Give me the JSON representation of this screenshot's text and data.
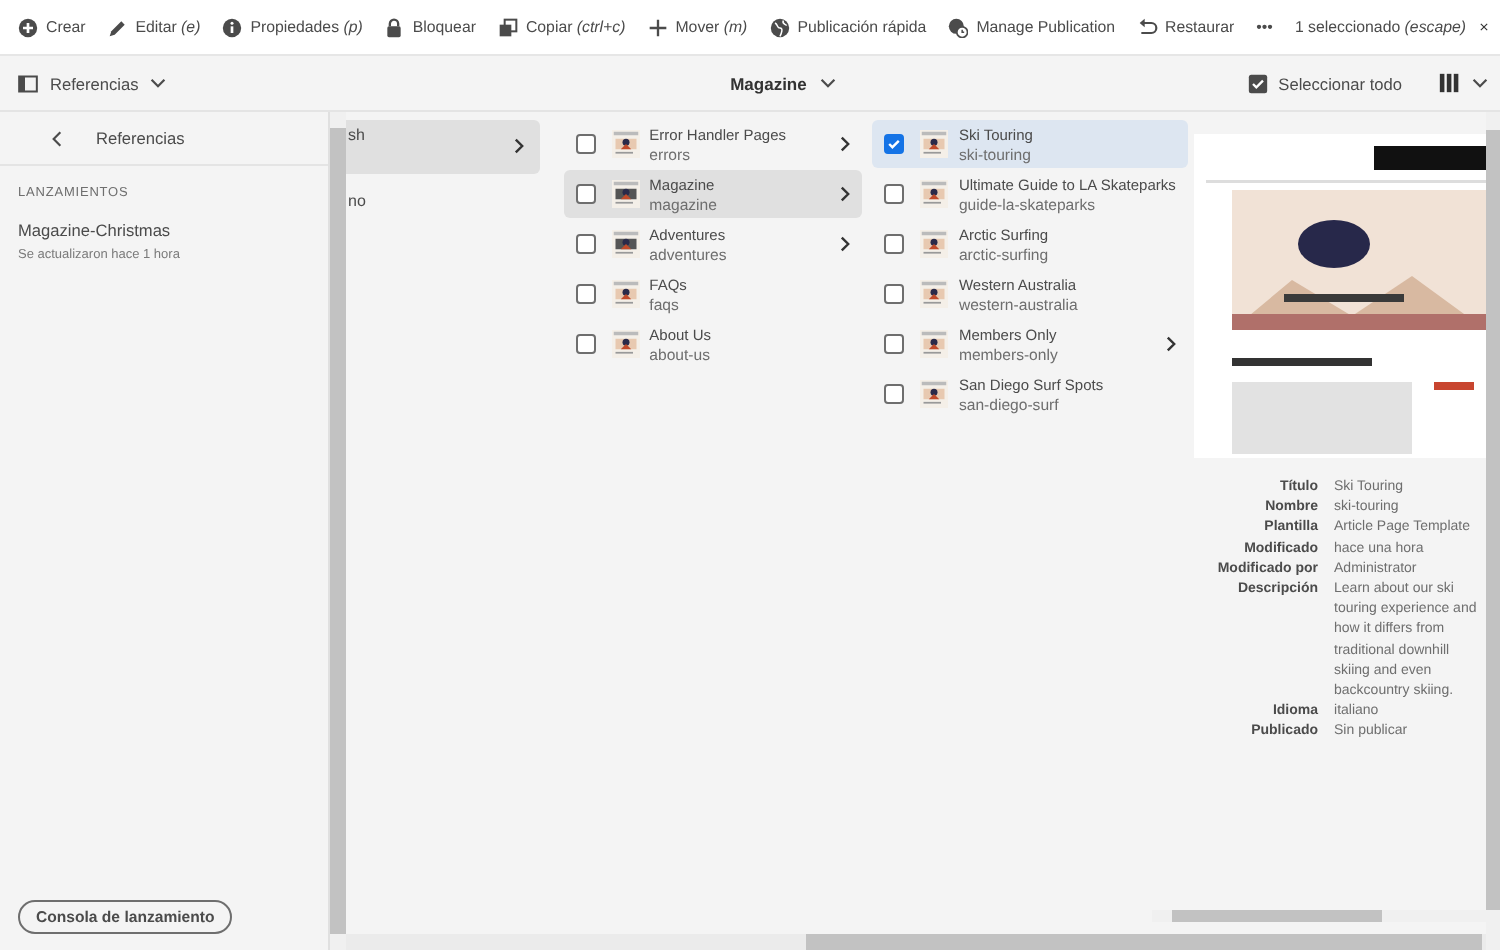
{
  "actionbar": {
    "actions": [
      {
        "kind": "create",
        "label": "Crear"
      },
      {
        "kind": "edit",
        "label": "Editar *(e)*"
      },
      {
        "kind": "info",
        "label": "Propiedades *(p)*"
      },
      {
        "kind": "lock",
        "label": "Bloquear"
      },
      {
        "kind": "copy",
        "label": "Copiar *(ctrl+c)*"
      },
      {
        "kind": "move",
        "label": "Mover *(m)*"
      },
      {
        "kind": "globe",
        "label": "Publicación rápida"
      },
      {
        "kind": "globe-clock",
        "label": "Manage Publication"
      },
      {
        "kind": "undo",
        "label": "Restaurar"
      },
      {
        "kind": "more",
        "label": "•••"
      }
    ],
    "selection": "1 seleccionado *(escape)*"
  },
  "subbar": {
    "rail_toggle": "Referencias",
    "title": "Magazine",
    "select_all": "Seleccionar todo"
  },
  "rail": {
    "title": "Referencias",
    "section": "LANZAMIENTOS",
    "launches": [
      {
        "name": "Magazine-Christmas",
        "updated": "Se actualizaron hace 1 hora"
      }
    ],
    "console_button": "Consola de lanzamiento"
  },
  "columns": [
    {
      "items": [
        {
          "title": "sh",
          "has_children": true,
          "selected": true
        },
        {
          "title": "no",
          "has_children": false,
          "selected": false
        }
      ]
    },
    {
      "items": [
        {
          "title": "Error Handler Pages",
          "name": "errors",
          "has_children": true,
          "selected": false,
          "checked": false
        },
        {
          "title": "Magazine",
          "name": "magazine",
          "has_children": true,
          "selected": true,
          "checked": false
        },
        {
          "title": "Adventures",
          "name": "adventures",
          "has_children": true,
          "selected": false,
          "checked": false
        },
        {
          "title": "FAQs",
          "name": "faqs",
          "has_children": false,
          "selected": false,
          "checked": false
        },
        {
          "title": "About Us",
          "name": "about-us",
          "has_children": false,
          "selected": false,
          "checked": false
        }
      ]
    },
    {
      "items": [
        {
          "title": "Ski Touring",
          "name": "ski-touring",
          "has_children": false,
          "selected": true,
          "checked": true
        },
        {
          "title": "Ultimate Guide to LA Skateparks",
          "name": "guide-la-skateparks",
          "has_children": false,
          "selected": false,
          "checked": false
        },
        {
          "title": "Arctic Surfing",
          "name": "arctic-surfing",
          "has_children": false,
          "selected": false,
          "checked": false
        },
        {
          "title": "Western Australia",
          "name": "western-australia",
          "has_children": false,
          "selected": false,
          "checked": false
        },
        {
          "title": "Members Only",
          "name": "members-only",
          "has_children": true,
          "selected": false,
          "checked": false
        },
        {
          "title": "San Diego Surf Spots",
          "name": "san-diego-surf",
          "has_children": false,
          "selected": false,
          "checked": false
        }
      ]
    }
  ],
  "preview": {
    "properties": [
      {
        "label": "Título",
        "value": "Ski Touring"
      },
      {
        "label": "Nombre",
        "value": "ski-touring"
      },
      {
        "label": "Plantilla",
        "value": "Article Page Template"
      },
      {
        "label": "Modificado",
        "value": "hace una hora"
      },
      {
        "label": "Modificado por",
        "value": "Administrator"
      },
      {
        "label": "Descripción",
        "value": "Learn about our ski touring experience and how it differs from traditional downhill skiing and even backcountry skiing."
      },
      {
        "label": "Idioma",
        "value": "italiano"
      },
      {
        "label": "Publicado",
        "value": "Sin publicar"
      }
    ]
  }
}
